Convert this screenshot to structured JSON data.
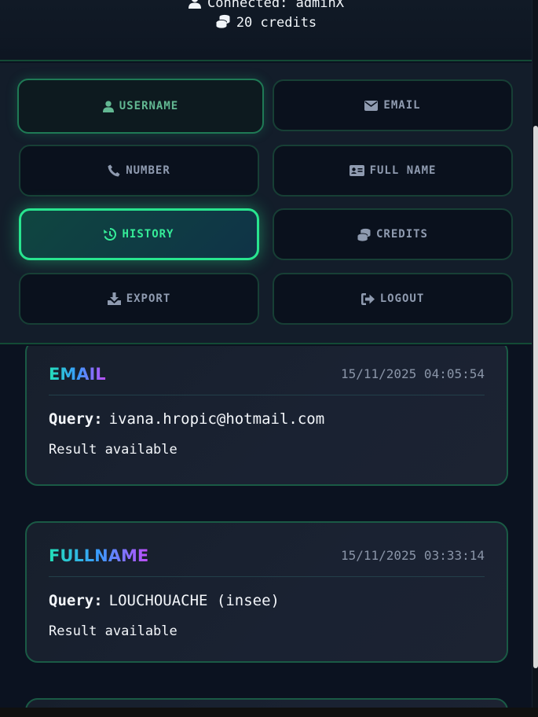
{
  "header": {
    "connected_text": "Connected: adminX",
    "credits_text": "20 credits",
    "icons": [
      "user-icon",
      "coins-icon"
    ]
  },
  "nav": {
    "buttons": [
      {
        "label": "USERNAME",
        "icon": "user-icon",
        "state": "hover"
      },
      {
        "label": "EMAIL",
        "icon": "envelope-icon",
        "state": "normal"
      },
      {
        "label": "NUMBER",
        "icon": "phone-icon",
        "state": "normal"
      },
      {
        "label": "FULL NAME",
        "icon": "id-card-icon",
        "state": "normal"
      },
      {
        "label": "HISTORY",
        "icon": "history-icon",
        "state": "active"
      },
      {
        "label": "CREDITS",
        "icon": "coins-icon",
        "state": "normal"
      },
      {
        "label": "EXPORT",
        "icon": "download-icon",
        "state": "normal"
      },
      {
        "label": "LOGOUT",
        "icon": "logout-icon",
        "state": "normal"
      }
    ]
  },
  "history": [
    {
      "type": "EMAIL",
      "timestamp": "15/11/2025 04:05:54",
      "query_label": "Query:",
      "query_value": "ivana.hropic@hotmail.com",
      "result": "Result available"
    },
    {
      "type": "FULLNAME",
      "timestamp": "15/11/2025 03:33:14",
      "query_label": "Query:",
      "query_value": "LOUCHOUACHE (insee)",
      "result": "Result available"
    }
  ],
  "colors": {
    "accent": "#28e58f",
    "background": "#0b1220",
    "card_border": "#1a5a45",
    "gradient_start": "#22e0b8",
    "gradient_end": "#c04dff"
  }
}
